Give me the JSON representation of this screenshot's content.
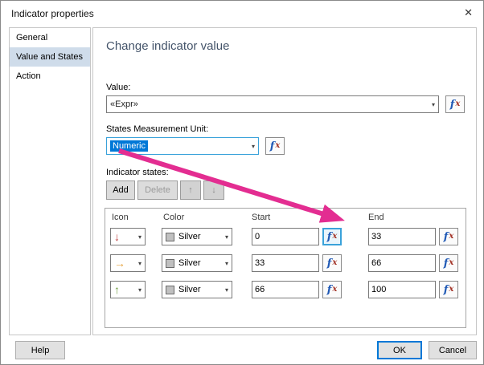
{
  "dialog": {
    "title": "Indicator properties",
    "close_icon": "✕"
  },
  "sidebar": {
    "items": [
      {
        "label": "General"
      },
      {
        "label": "Value and States"
      },
      {
        "label": "Action"
      }
    ]
  },
  "main": {
    "heading": "Change indicator value",
    "value": {
      "label": "Value:",
      "text": "«Expr»"
    },
    "unit": {
      "label": "States Measurement Unit:",
      "value": "Numeric"
    },
    "states": {
      "label": "Indicator states:",
      "add": "Add",
      "delete": "Delete",
      "table": {
        "headers": [
          "Icon",
          "Color",
          "Start",
          "End"
        ],
        "rows": [
          {
            "icon": "down-arrow",
            "icon_glyph": "↓",
            "icon_color": "#bf4040",
            "color": "Silver",
            "start": "0",
            "end": "33"
          },
          {
            "icon": "right-arrow",
            "icon_glyph": "→",
            "icon_color": "#e6a23c",
            "color": "Silver",
            "start": "33",
            "end": "66"
          },
          {
            "icon": "up-arrow",
            "icon_glyph": "↑",
            "icon_color": "#6f9e3f",
            "color": "Silver",
            "start": "66",
            "end": "100"
          }
        ]
      }
    },
    "fx_f": "f",
    "fx_x": "x"
  },
  "footer": {
    "help": "Help",
    "ok": "OK",
    "cancel": "Cancel"
  },
  "icons": {
    "caret": "▾",
    "move_up": "↑",
    "move_down": "↓"
  },
  "colors": {
    "annotation_arrow": "#e32d91",
    "silver_swatch": "#c0c0c0",
    "selection_blue": "#0078d7",
    "focus_highlight": "#3aa2da"
  }
}
